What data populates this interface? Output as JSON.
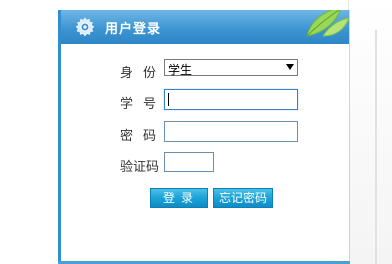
{
  "header": {
    "title": "用户登录"
  },
  "form": {
    "identity_label": "身份",
    "identity_value": "学生",
    "id_label": "学号",
    "id_value": "",
    "password_label": "密码",
    "password_value": "",
    "captcha_label": "验证码",
    "captcha_value": ""
  },
  "buttons": {
    "login": "登录",
    "forgot_password": "忘记密码"
  },
  "colors": {
    "header_blue": "#3d95d2",
    "button_blue": "#1aa3d8",
    "leaf_green": "#8fd14f"
  },
  "icons": [
    "gear-icon",
    "leaf-icon",
    "chevron-down-icon"
  ]
}
